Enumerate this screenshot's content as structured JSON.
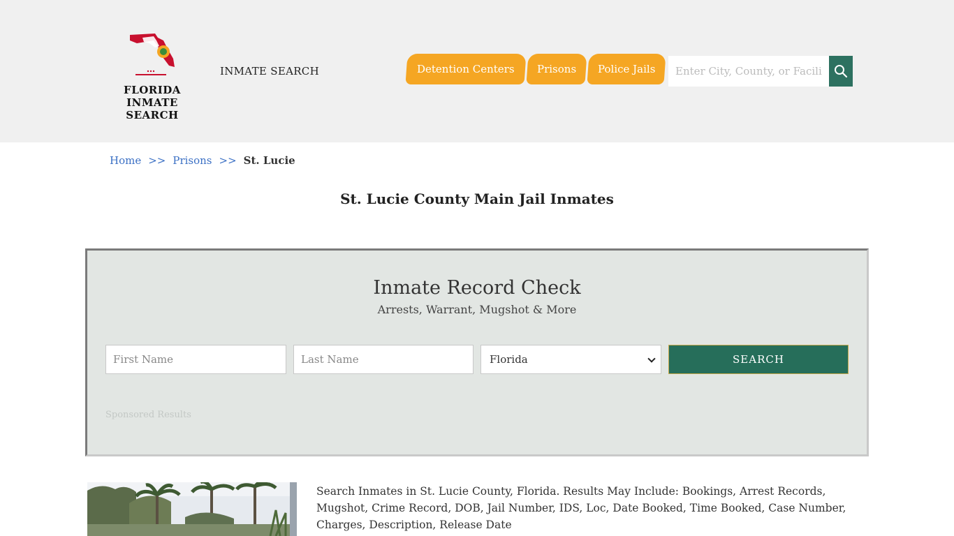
{
  "header": {
    "logo": {
      "line1": "FLORIDA",
      "line2": "INMATE SEARCH"
    },
    "site_name": "INMATE SEARCH",
    "nav": [
      {
        "label": "Detention Centers"
      },
      {
        "label": "Prisons"
      },
      {
        "label": "Police Jails"
      }
    ],
    "search": {
      "placeholder": "Enter City, County, or Facility"
    },
    "colors": {
      "background": "#f0f0f0",
      "tab": "#f5a623",
      "search_button": "#2d7160"
    }
  },
  "breadcrumb": {
    "items": [
      "Home",
      "Prisons"
    ],
    "separator": ">>",
    "current": "St. Lucie"
  },
  "page_title": "St. Lucie County Main Jail Inmates",
  "record_check": {
    "title": "Inmate Record Check",
    "subtitle": "Arrests, Warrant, Mugshot & More",
    "first_name_placeholder": "First Name",
    "last_name_placeholder": "Last Name",
    "state_selected": "Florida",
    "search_label": "SEARCH",
    "sponsored": "Sponsored Results",
    "colors": {
      "panel": "#e2e6e3",
      "button": "#266e5a"
    }
  },
  "content": {
    "description": "Search Inmates in St. Lucie County, Florida. Results May Include: Bookings, Arrest Records, Mugshot, Crime Record, DOB, Jail Number, IDS, Loc, Date Booked, Time Booked, Case Number, Charges, Description, Release Date"
  }
}
